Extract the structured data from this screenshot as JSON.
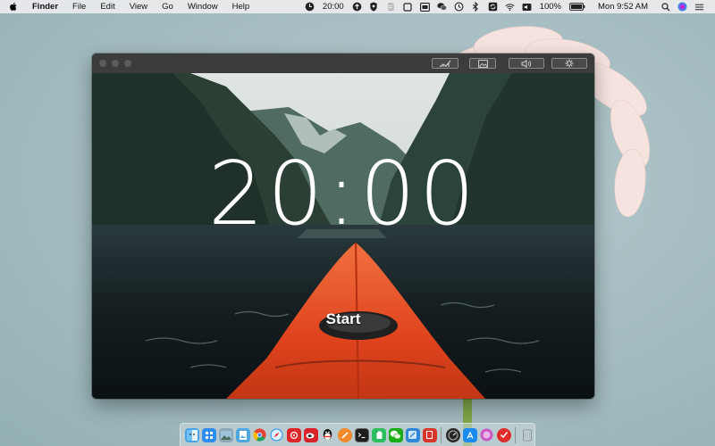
{
  "menubar": {
    "app_name": "Finder",
    "menus": [
      "File",
      "Edit",
      "View",
      "Go",
      "Window",
      "Help"
    ],
    "timer_status": "20:00",
    "battery": "100%",
    "clock": "Mon 9:52 AM",
    "icons": [
      "apple-icon",
      "timer-icon",
      "upload-icon",
      "shield-icon",
      "evernote-icon",
      "square-icon",
      "window-icon",
      "wechat-icon",
      "time-machine-icon",
      "bluetooth-icon",
      "sync-icon",
      "wifi-icon",
      "volume-icon",
      "battery-icon",
      "search-icon",
      "siri-icon",
      "control-center-icon"
    ]
  },
  "window": {
    "toolbar": [
      "stats-icon",
      "image-icon",
      "sound-icon",
      "settings-icon"
    ],
    "timer": "20:00",
    "start_label": "Start"
  },
  "dock": {
    "apps": [
      "finder",
      "launchpad",
      "photos",
      "preview",
      "chrome",
      "safari",
      "netease-music",
      "weibo",
      "qq",
      "paw",
      "terminal",
      "evernote",
      "wechat",
      "xcode",
      "books",
      "activity",
      "app-store",
      "arc",
      "todo",
      "trash"
    ]
  }
}
